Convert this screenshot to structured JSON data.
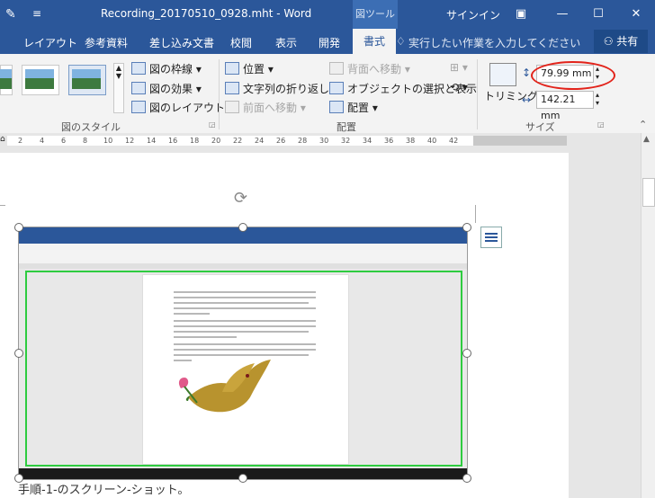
{
  "titlebar": {
    "filename": "Recording_20170510_0928.mht - Word",
    "context_tool": "図ツール",
    "signin": "サインイン",
    "qat_icon": "save-icon",
    "colors": {
      "bar": "#2b579a"
    }
  },
  "tabs": {
    "layout": "レイアウト",
    "references": "参考資料",
    "mailings": "差し込み文書",
    "review": "校閲",
    "view": "表示",
    "developer": "開発",
    "format": "書式",
    "tell_me": "実行したい作業を入力してください",
    "share": "共有"
  },
  "ribbon": {
    "picture_styles": {
      "border": "図の枠線",
      "effects": "図の効果",
      "layout": "図のレイアウト",
      "group_label": "図のスタイル"
    },
    "arrange": {
      "position": "位置",
      "wrap_text": "文字列の折り返し",
      "bring_forward": "前面へ移動",
      "send_backward": "背面へ移動",
      "selection_pane": "オブジェクトの選択と表示",
      "align": "配置",
      "group_label": "配置"
    },
    "size": {
      "crop": "トリミング",
      "height": "79.99 mm",
      "width": "142.21 mm",
      "group_label": "サイズ"
    }
  },
  "ruler": {
    "ticks": [
      "2",
      "4",
      "6",
      "8",
      "10",
      "12",
      "14",
      "16",
      "18",
      "20",
      "22",
      "24",
      "26",
      "28",
      "30",
      "32",
      "34",
      "36",
      "38",
      "40",
      "42"
    ]
  },
  "document": {
    "caption": "手順-1-のスクリーン-ショット。"
  }
}
